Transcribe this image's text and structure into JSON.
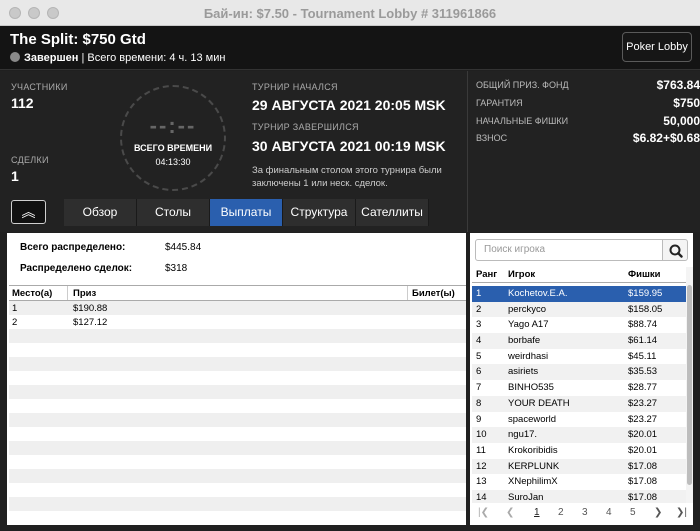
{
  "window": {
    "title": "Бай-ин: $7.50 - Tournament Lobby # 311961866"
  },
  "header": {
    "name": "The Split: $750 Gtd",
    "status": "Завершен",
    "total_time": "| Всего времени: 4 ч. 13 мин",
    "lobby_button": "Poker Lobby"
  },
  "info": {
    "participants_label": "УЧАСТНИКИ",
    "participants": "112",
    "deals_label": "СДЕЛКИ",
    "deals": "1",
    "clock_digits": "--:--",
    "clock_label": "ВСЕГО ВРЕМЕНИ",
    "clock_time": "04:13:30",
    "started_label": "ТУРНИР НАЧАЛСЯ",
    "started": "29 АВГУСТА 2021  20:05 MSK",
    "finished_label": "ТУРНИР ЗАВЕРШИЛСЯ",
    "finished": "30 АВГУСТА 2021  00:19 MSK",
    "note": "За финальным столом этого турнира были заключены 1 или неск. сделок."
  },
  "prize": {
    "pool_label": "ОБЩИЙ ПРИЗ. ФОНД",
    "pool": "$763.84",
    "guarantee_label": "ГАРАНТИЯ",
    "guarantee": "$750",
    "chips_label": "НАЧАЛЬНЫЕ ФИШКИ",
    "chips": "50,000",
    "buyin_label": "ВЗНОС",
    "buyin": "$6.82+$0.68"
  },
  "tabs": [
    "Обзор",
    "Столы",
    "Выплаты",
    "Структура",
    "Сателлиты"
  ],
  "payouts": {
    "distributed_label": "Всего распределено:",
    "distributed": "$445.84",
    "deals_label": "Распределено сделок:",
    "deals": "$318",
    "columns": [
      "Место(а)",
      "Приз",
      "Билет(ы)"
    ],
    "rows": [
      [
        "1",
        "$190.88"
      ],
      [
        "2",
        "$127.12"
      ]
    ]
  },
  "players": {
    "search_placeholder": "Поиск игрока",
    "columns": [
      "Ранг",
      "Игрок",
      "Фишки"
    ],
    "rows": [
      [
        "1",
        "Kochetov.E.A.",
        "$159.95"
      ],
      [
        "2",
        "perckyco",
        "$158.05"
      ],
      [
        "3",
        "Yago A17",
        "$88.74"
      ],
      [
        "4",
        "borbafe",
        "$61.14"
      ],
      [
        "5",
        "weirdhasi",
        "$45.11"
      ],
      [
        "6",
        "asiriets",
        "$35.53"
      ],
      [
        "7",
        "BINHO535",
        "$28.77"
      ],
      [
        "8",
        "YOUR DEATH",
        "$23.27"
      ],
      [
        "9",
        "spaceworld",
        "$23.27"
      ],
      [
        "10",
        "ngu17.",
        "$20.01"
      ],
      [
        "11",
        "Krokoribidis",
        "$20.01"
      ],
      [
        "12",
        "KERPLUNK",
        "$17.08"
      ],
      [
        "13",
        "XNephilimX",
        "$17.08"
      ],
      [
        "14",
        "SuroJan",
        "$17.08"
      ]
    ],
    "pages": [
      "1",
      "2",
      "3",
      "4",
      "5"
    ]
  }
}
